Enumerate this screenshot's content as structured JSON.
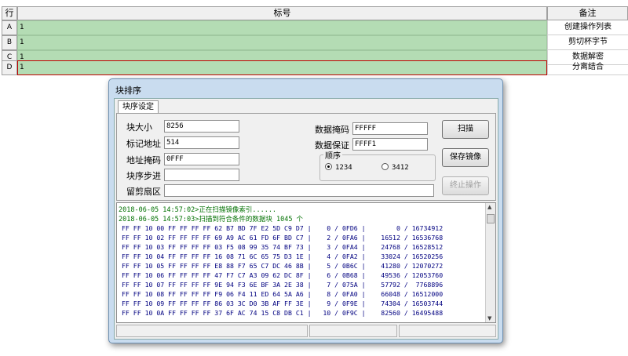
{
  "grid": {
    "col_row": "行",
    "col_tag": "标号",
    "col_note": "备注",
    "rows": [
      {
        "id": "A",
        "value": "1",
        "note": "创建操作列表"
      },
      {
        "id": "B",
        "value": "1",
        "note": "剪切杯字节"
      },
      {
        "id": "C",
        "value": "1",
        "note": "数据解密"
      },
      {
        "id": "D",
        "value": "1",
        "note": "分离结合"
      }
    ]
  },
  "dialog": {
    "title": "块排序",
    "tab": "块序设定",
    "fields": {
      "block_size_label": "块大小",
      "block_size": "8256",
      "tag_addr_label": "标记地址",
      "tag_addr": "514",
      "addr_mask_label": "地址掩码",
      "addr_mask": "0FFF",
      "block_step_label": "块序步进",
      "block_step": "",
      "reserve_label": "留剪扇区",
      "reserve": "",
      "data_mask_label": "数据掩码",
      "data_mask": "FFFFF",
      "data_guard_label": "数据保证",
      "data_guard": "FFFF1"
    },
    "order": {
      "label": "顺序",
      "opt1": "1234",
      "opt2": "3412"
    },
    "buttons": {
      "scan": "扫描",
      "save": "保存镜像",
      "stop": "终止操作"
    },
    "log": [
      "2018-06-05 14:57:02>正在扫描镜像索引......",
      "2018-06-05 14:57:03>扫描到符合条件的数据块 1045 个"
    ],
    "hex": [
      "FF FF 10 00 FF FF FF FF 62 B7 BD 7F E2 5D C9 D7 |    0 / 0FD6 |        0 / 16734912",
      "FF FF 10 02 FF FF FF FF 69 A9 AC 61 FD 6F BD C7 |    2 / 0FA6 |    16512 / 16536768",
      "FF FF 10 03 FF FF FF FF 03 F5 08 99 35 74 BF 73 |    3 / 0FA4 |    24768 / 16528512",
      "FF FF 10 04 FF FF FF FF 16 08 71 6C 65 75 D3 1E |    4 / 0FA2 |    33024 / 16520256",
      "FF FF 10 05 FF FF FF FF E8 88 F7 65 C7 DC 46 8B |    5 / 0B6C |    41280 / 12070272",
      "FF FF 10 06 FF FF FF FF 47 F7 C7 A3 09 62 DC 8F |    6 / 0B68 |    49536 / 12053760",
      "FF FF 10 07 FF FF FF FF 9E 94 F3 6E BF 3A 2E 38 |    7 / 075A |    57792 /  7768896",
      "FF FF 10 08 FF FF FF FF F9 06 F4 11 ED 64 5A A6 |    8 / 0FA0 |    66048 / 16512000",
      "FF FF 10 09 FF FF FF FF 86 03 3C D0 3B AF FF 3E |    9 / 0F9E |    74304 / 16503744",
      "FF FF 10 0A FF FF FF FF 37 6F AC 74 15 C8 DB C1 |   10 / 0F9C |    82560 / 16495488"
    ]
  }
}
